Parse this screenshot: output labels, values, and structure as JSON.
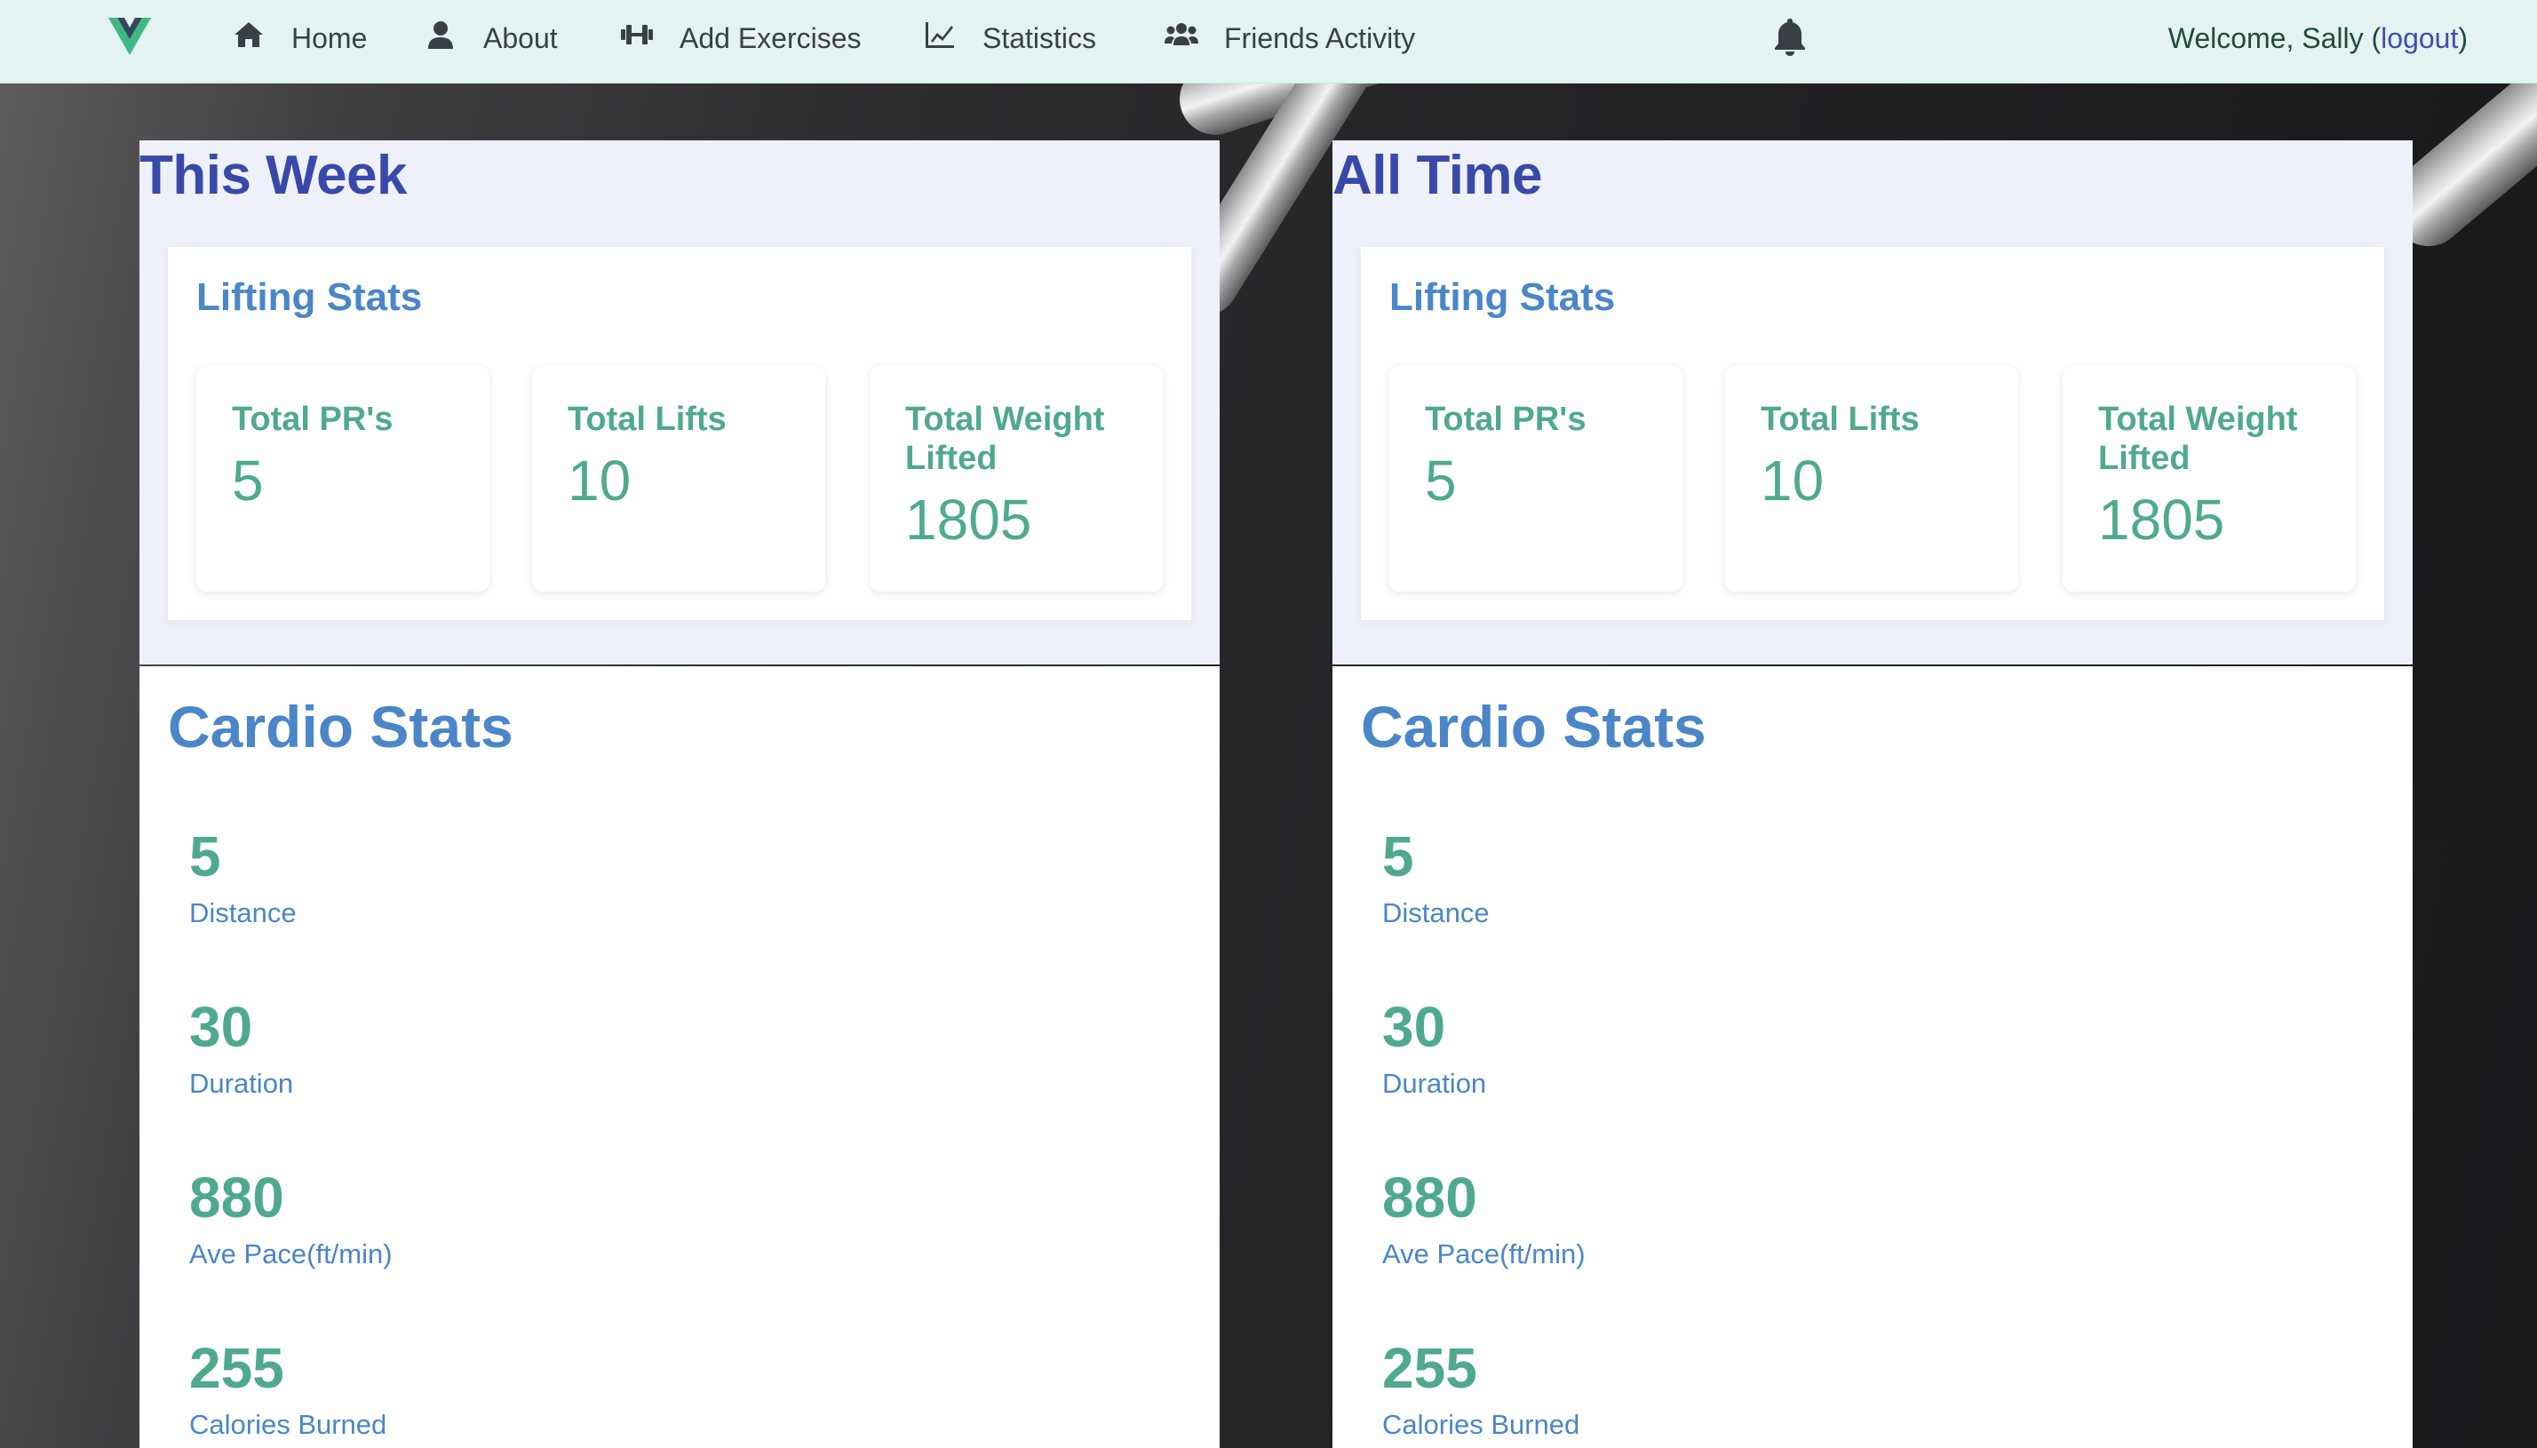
{
  "nav": {
    "items": [
      {
        "label": "Home",
        "icon": "home-icon"
      },
      {
        "label": "About",
        "icon": "user-icon"
      },
      {
        "label": "Add Exercises",
        "icon": "dumbbell-icon"
      },
      {
        "label": "Statistics",
        "icon": "chart-line-icon"
      },
      {
        "label": "Friends Activity",
        "icon": "users-icon"
      }
    ],
    "welcome_prefix": "Welcome, Sally (",
    "logout": "logout",
    "welcome_suffix": ")"
  },
  "colors": {
    "nav_bg": "#e4f2f1",
    "title": "#3949a9",
    "section": "#4a86c8",
    "stat": "#4fa990"
  },
  "columns": [
    {
      "title": "This Week",
      "lifting_title": "Lifting Stats",
      "lifting": [
        {
          "label": "Total PR's",
          "value": "5"
        },
        {
          "label": "Total Lifts",
          "value": "10"
        },
        {
          "label": "Total Weight Lifted",
          "value": "1805"
        }
      ],
      "cardio_title": "Cardio Stats",
      "cardio": [
        {
          "value": "5",
          "label": "Distance"
        },
        {
          "value": "30",
          "label": "Duration"
        },
        {
          "value": "880",
          "label": "Ave Pace(ft/min)"
        },
        {
          "value": "255",
          "label": "Calories Burned"
        }
      ]
    },
    {
      "title": "All Time",
      "lifting_title": "Lifting Stats",
      "lifting": [
        {
          "label": "Total PR's",
          "value": "5"
        },
        {
          "label": "Total Lifts",
          "value": "10"
        },
        {
          "label": "Total Weight Lifted",
          "value": "1805"
        }
      ],
      "cardio_title": "Cardio Stats",
      "cardio": [
        {
          "value": "5",
          "label": "Distance"
        },
        {
          "value": "30",
          "label": "Duration"
        },
        {
          "value": "880",
          "label": "Ave Pace(ft/min)"
        },
        {
          "value": "255",
          "label": "Calories Burned"
        }
      ]
    }
  ]
}
